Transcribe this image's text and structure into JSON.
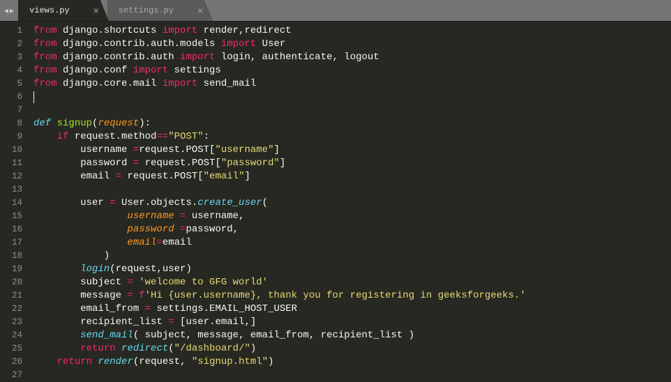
{
  "tabs": {
    "nav_left": "◂",
    "nav_right": "▸",
    "items": [
      {
        "label": "views.py",
        "active": true
      },
      {
        "label": "settings.py",
        "active": false
      }
    ],
    "close_glyph": "×"
  },
  "gutter": [
    "1",
    "2",
    "3",
    "4",
    "5",
    "6",
    "7",
    "8",
    "9",
    "10",
    "11",
    "12",
    "13",
    "14",
    "15",
    "16",
    "17",
    "18",
    "19",
    "20",
    "21",
    "22",
    "23",
    "24",
    "25",
    "26",
    "27"
  ],
  "code": [
    [
      {
        "c": "k-red",
        "t": "from"
      },
      {
        "c": "k-white",
        "t": " django.shortcuts "
      },
      {
        "c": "k-red",
        "t": "import"
      },
      {
        "c": "k-white",
        "t": " render,redirect"
      }
    ],
    [
      {
        "c": "k-red",
        "t": "from"
      },
      {
        "c": "k-white",
        "t": " django.contrib.auth.models "
      },
      {
        "c": "k-red",
        "t": "import"
      },
      {
        "c": "k-white",
        "t": " User"
      }
    ],
    [
      {
        "c": "k-red",
        "t": "from"
      },
      {
        "c": "k-white",
        "t": " django.contrib.auth "
      },
      {
        "c": "k-red",
        "t": "import"
      },
      {
        "c": "k-white",
        "t": " login, authenticate, logout"
      }
    ],
    [
      {
        "c": "k-red",
        "t": "from"
      },
      {
        "c": "k-white",
        "t": " django.conf "
      },
      {
        "c": "k-red",
        "t": "import"
      },
      {
        "c": "k-white",
        "t": " settings"
      }
    ],
    [
      {
        "c": "k-red",
        "t": "from"
      },
      {
        "c": "k-white",
        "t": " django.core.mail "
      },
      {
        "c": "k-red",
        "t": "import"
      },
      {
        "c": "k-white",
        "t": " send_mail"
      }
    ],
    [],
    [],
    [
      {
        "c": "k-blue",
        "t": "def"
      },
      {
        "c": "k-white",
        "t": " "
      },
      {
        "c": "k-green",
        "t": "signup"
      },
      {
        "c": "k-white",
        "t": "("
      },
      {
        "c": "k-orange",
        "t": "request"
      },
      {
        "c": "k-white",
        "t": "):"
      }
    ],
    [
      {
        "c": "k-white",
        "t": "    "
      },
      {
        "c": "k-red",
        "t": "if"
      },
      {
        "c": "k-white",
        "t": " request.method"
      },
      {
        "c": "k-red",
        "t": "=="
      },
      {
        "c": "k-yellow",
        "t": "\"POST\""
      },
      {
        "c": "k-white",
        "t": ":"
      }
    ],
    [
      {
        "c": "k-white",
        "t": "        username "
      },
      {
        "c": "k-red",
        "t": "="
      },
      {
        "c": "k-white",
        "t": "request.POST["
      },
      {
        "c": "k-yellow",
        "t": "\"username\""
      },
      {
        "c": "k-white",
        "t": "]"
      }
    ],
    [
      {
        "c": "k-white",
        "t": "        password "
      },
      {
        "c": "k-red",
        "t": "="
      },
      {
        "c": "k-white",
        "t": " request.POST["
      },
      {
        "c": "k-yellow",
        "t": "\"password\""
      },
      {
        "c": "k-white",
        "t": "]"
      }
    ],
    [
      {
        "c": "k-white",
        "t": "        email "
      },
      {
        "c": "k-red",
        "t": "="
      },
      {
        "c": "k-white",
        "t": " request.POST["
      },
      {
        "c": "k-yellow",
        "t": "\"email\""
      },
      {
        "c": "k-white",
        "t": "]"
      }
    ],
    [],
    [
      {
        "c": "k-white",
        "t": "        user "
      },
      {
        "c": "k-red",
        "t": "="
      },
      {
        "c": "k-white",
        "t": " User.objects."
      },
      {
        "c": "k-blue",
        "t": "create_user"
      },
      {
        "c": "k-white",
        "t": "("
      }
    ],
    [
      {
        "c": "k-white",
        "t": "                "
      },
      {
        "c": "k-orange",
        "t": "username"
      },
      {
        "c": "k-white",
        "t": " "
      },
      {
        "c": "k-red",
        "t": "="
      },
      {
        "c": "k-white",
        "t": " username,"
      }
    ],
    [
      {
        "c": "k-white",
        "t": "                "
      },
      {
        "c": "k-orange",
        "t": "password"
      },
      {
        "c": "k-white",
        "t": " "
      },
      {
        "c": "k-red",
        "t": "="
      },
      {
        "c": "k-white",
        "t": "password,"
      }
    ],
    [
      {
        "c": "k-white",
        "t": "                "
      },
      {
        "c": "k-orange",
        "t": "email"
      },
      {
        "c": "k-red",
        "t": "="
      },
      {
        "c": "k-white",
        "t": "email"
      }
    ],
    [
      {
        "c": "k-white",
        "t": "            )"
      }
    ],
    [
      {
        "c": "k-white",
        "t": "        "
      },
      {
        "c": "k-blue",
        "t": "login"
      },
      {
        "c": "k-white",
        "t": "(request,user)"
      }
    ],
    [
      {
        "c": "k-white",
        "t": "        subject "
      },
      {
        "c": "k-red",
        "t": "="
      },
      {
        "c": "k-white",
        "t": " "
      },
      {
        "c": "k-yellow",
        "t": "'welcome to GFG world'"
      }
    ],
    [
      {
        "c": "k-white",
        "t": "        message "
      },
      {
        "c": "k-red",
        "t": "="
      },
      {
        "c": "k-white",
        "t": " "
      },
      {
        "c": "k-red",
        "t": "f"
      },
      {
        "c": "k-yellow",
        "t": "'Hi {user.username}, thank you for registering in geeksforgeeks.'"
      }
    ],
    [
      {
        "c": "k-white",
        "t": "        email_from "
      },
      {
        "c": "k-red",
        "t": "="
      },
      {
        "c": "k-white",
        "t": " settings.EMAIL_HOST_USER"
      }
    ],
    [
      {
        "c": "k-white",
        "t": "        recipient_list "
      },
      {
        "c": "k-red",
        "t": "="
      },
      {
        "c": "k-white",
        "t": " [user.email,]"
      }
    ],
    [
      {
        "c": "k-white",
        "t": "        "
      },
      {
        "c": "k-blue",
        "t": "send_mail"
      },
      {
        "c": "k-white",
        "t": "( subject, message, email_from, recipient_list )"
      }
    ],
    [
      {
        "c": "k-white",
        "t": "        "
      },
      {
        "c": "k-red",
        "t": "return"
      },
      {
        "c": "k-white",
        "t": " "
      },
      {
        "c": "k-blue",
        "t": "redirect"
      },
      {
        "c": "k-white",
        "t": "("
      },
      {
        "c": "k-yellow",
        "t": "\"/dashboard/\""
      },
      {
        "c": "k-white",
        "t": ")"
      }
    ],
    [
      {
        "c": "k-white",
        "t": "    "
      },
      {
        "c": "k-red",
        "t": "return"
      },
      {
        "c": "k-white",
        "t": " "
      },
      {
        "c": "k-blue",
        "t": "render"
      },
      {
        "c": "k-white",
        "t": "(request, "
      },
      {
        "c": "k-yellow",
        "t": "\"signup.html\""
      },
      {
        "c": "k-white",
        "t": ")"
      }
    ],
    []
  ],
  "cursor_line_index": 5
}
